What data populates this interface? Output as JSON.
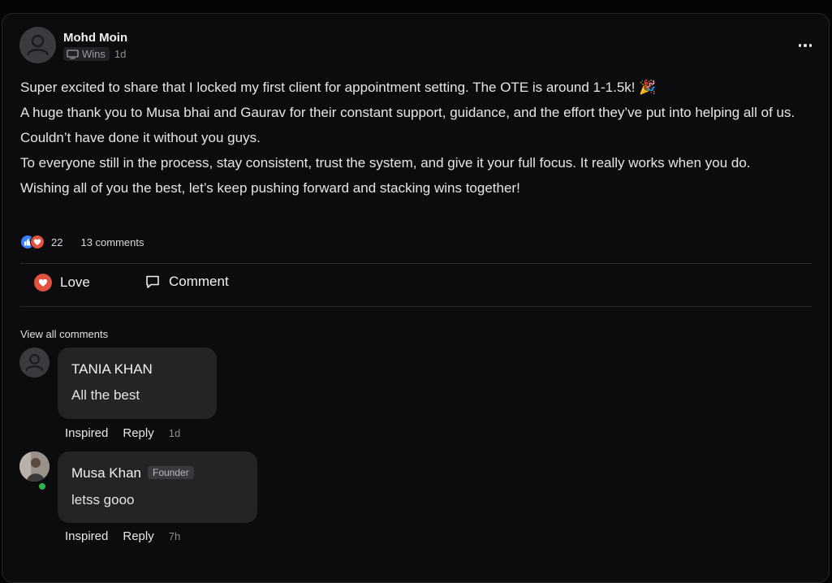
{
  "post": {
    "author": "Mohd Moin",
    "category": "Wins",
    "time": "1d",
    "paragraphs": [
      "Super excited to share that I locked my first client for appointment setting. The OTE is around 1-1.5k! 🎉",
      "A huge thank you to Musa bhai and Gaurav for their constant support, guidance, and the effort they’ve put into helping all of us. Couldn’t have done it without you guys.",
      "To everyone still in the process, stay consistent, trust the system, and give it your full focus. It really works when you do.",
      "Wishing all of you the best, let’s keep pushing forward and stacking wins together!"
    ],
    "reaction_count": "22",
    "comment_count": "13 comments"
  },
  "actions": {
    "love": "Love",
    "comment": "Comment"
  },
  "view_all": "View all comments",
  "comments": [
    {
      "author": "TANIA KHAN",
      "text": "All the best",
      "inspired": "Inspired",
      "reply": "Reply",
      "time": "1d"
    },
    {
      "author": "Musa Khan",
      "badge": "Founder",
      "text": "letss gooo",
      "inspired": "Inspired",
      "reply": "Reply",
      "time": "7h"
    }
  ],
  "colors": {
    "love": "#e0523f",
    "like": "#3b82f6",
    "online": "#2fb24c"
  },
  "icons": [
    "user-avatar-icon",
    "monitor-icon",
    "more-dots-icon",
    "thumbs-up-icon",
    "heart-icon",
    "comment-icon"
  ]
}
